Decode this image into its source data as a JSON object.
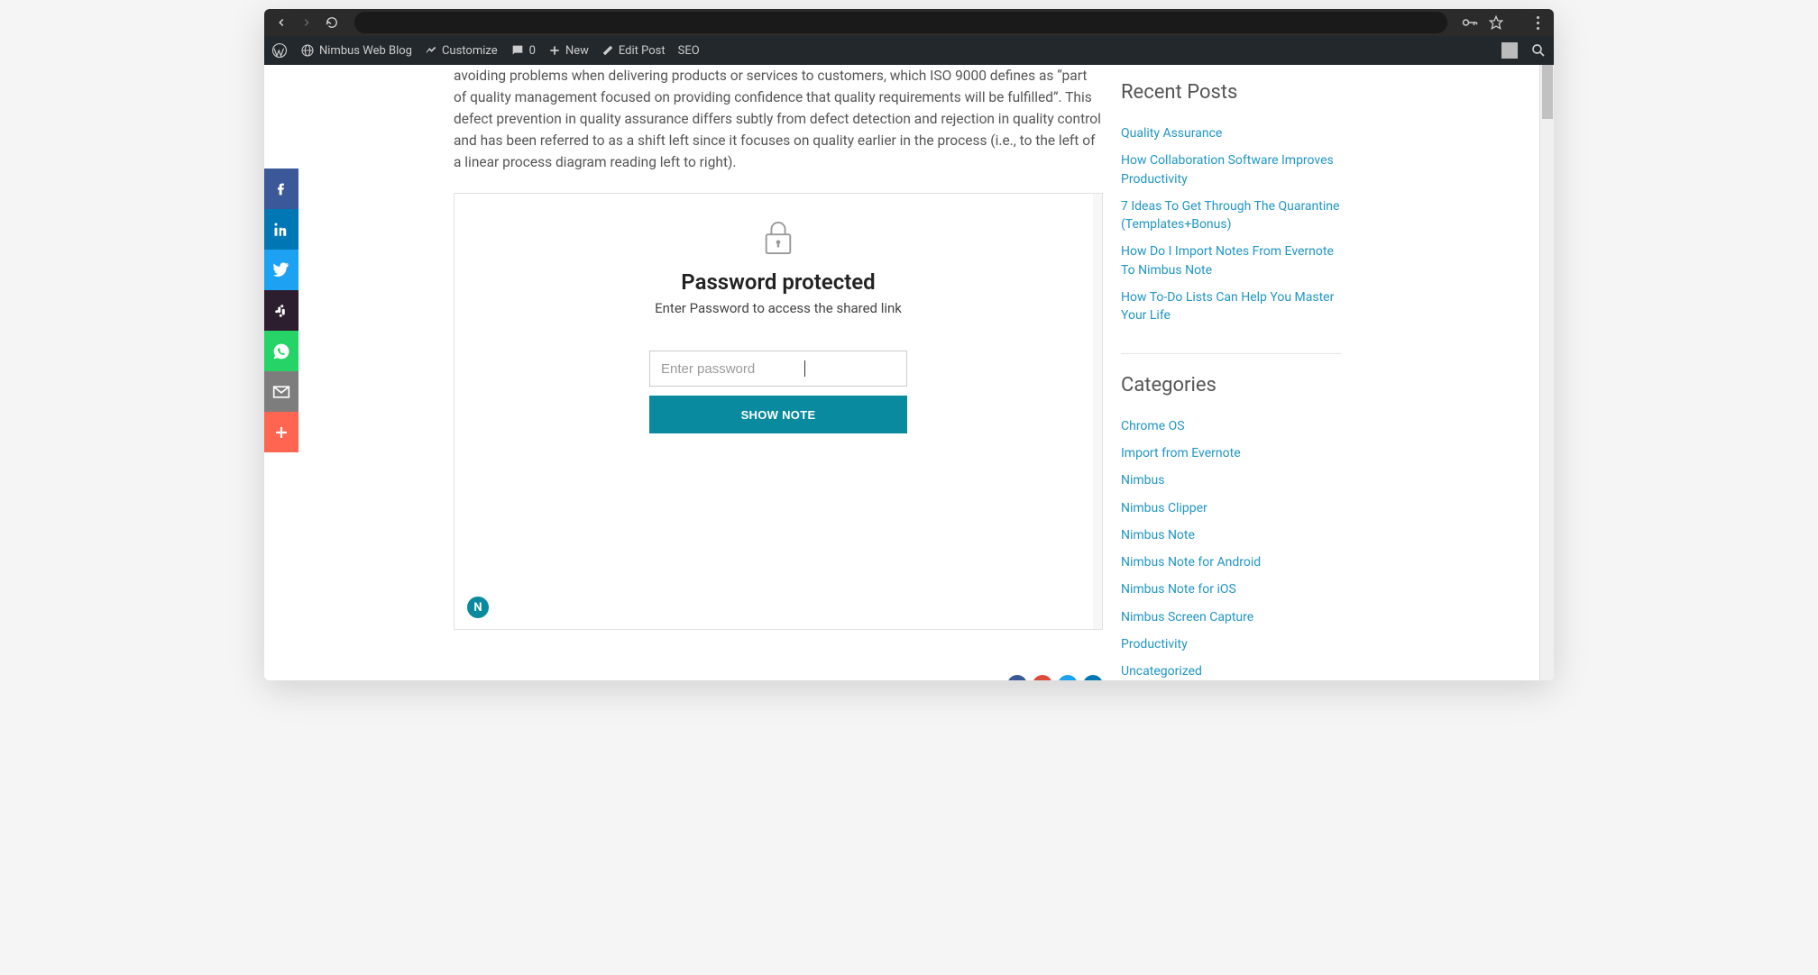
{
  "wp_bar": {
    "site_name": "Nimbus Web Blog",
    "customize_label": "Customize",
    "comments_count": "0",
    "new_label": "New",
    "edit_post_label": "Edit Post",
    "seo_label": "SEO"
  },
  "article": {
    "paragraph": "avoiding problems when delivering products or services to customers, which ISO 9000 defines as “part of quality management focused on providing confidence that quality requirements will be fulfilled”. This defect prevention in quality assurance differs subtly from defect detection and rejection in quality control and has been referred to as a shift left since it focuses on quality earlier in the process (i.e., to the left of a linear process diagram reading left to right)."
  },
  "password_card": {
    "title": "Password protected",
    "subtitle": "Enter Password to access the shared link",
    "placeholder": "Enter password",
    "button_label": "SHOW NOTE",
    "badge_letter": "N"
  },
  "sidebar": {
    "recent_heading": "Recent Posts",
    "recent_posts": [
      "Quality Assurance",
      "How Collaboration Software Improves Productivity",
      "7 Ideas To Get Through The Quarantine (Templates+Bonus)",
      "How Do I Import Notes From Evernote To Nimbus Note",
      "How To-Do Lists Can Help You Master Your Life"
    ],
    "categories_heading": "Categories",
    "categories": [
      "Chrome OS",
      "Import from Evernote",
      "Nimbus",
      "Nimbus Clipper",
      "Nimbus Note",
      "Nimbus Note for Android",
      "Nimbus Note for iOS",
      "Nimbus Screen Capture",
      "Productivity",
      "Uncategorized"
    ]
  },
  "social_icons": {
    "facebook": "f",
    "linkedin": "in",
    "twitter": "tw",
    "slack": "sl",
    "whatsapp": "wa",
    "email": "em",
    "add": "+"
  },
  "share_icons": {
    "fb": "f",
    "gp": "G+",
    "tw": "tw",
    "li": "in"
  }
}
